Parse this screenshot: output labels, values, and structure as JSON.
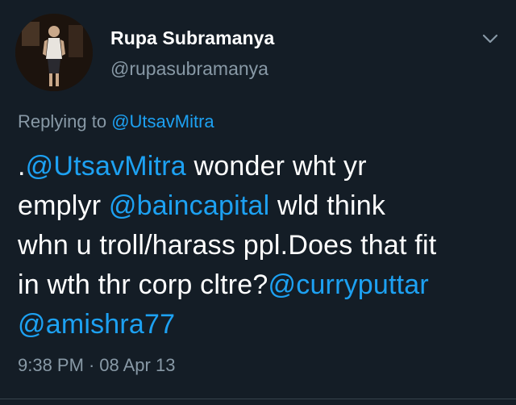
{
  "author": {
    "display_name": "Rupa Subramanya",
    "handle": "@rupasubramanya"
  },
  "reply": {
    "prefix": "Replying to ",
    "mention": "@UtsavMitra"
  },
  "tweet": {
    "segments": [
      {
        "text": ".",
        "type": "text"
      },
      {
        "text": "@UtsavMitra",
        "type": "mention"
      },
      {
        "text": " wonder wht yr\nemplyr ",
        "type": "text"
      },
      {
        "text": "@baincapital",
        "type": "mention"
      },
      {
        "text": " wld think\nwhn u troll/harass ppl.Does that fit\nin wth thr corp cltre?",
        "type": "text"
      },
      {
        "text": "@curryputtar",
        "type": "mention"
      },
      {
        "text": "\n",
        "type": "text"
      },
      {
        "text": "@amishra77",
        "type": "mention"
      }
    ]
  },
  "meta": {
    "time": "9:38 PM",
    "separator": "·",
    "date": "08 Apr 13"
  },
  "icons": {
    "menu": "chevron-down-icon",
    "avatar": "profile-photo"
  },
  "colors": {
    "background": "#141d26",
    "accent": "#1da1f2",
    "secondary_text": "#8899a6",
    "primary_text": "#ffffff"
  }
}
